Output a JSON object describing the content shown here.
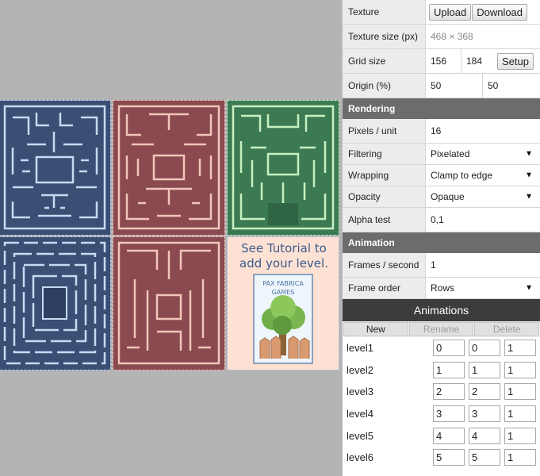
{
  "panel": {
    "texture": {
      "label": "Texture",
      "upload": "Upload",
      "download": "Download"
    },
    "texture_size": {
      "label": "Texture size (px)",
      "value": "468 × 368"
    },
    "grid_size": {
      "label": "Grid size",
      "w": "156",
      "h": "184",
      "setup": "Setup"
    },
    "origin": {
      "label": "Origin (%)",
      "x": "50",
      "y": "50"
    },
    "rendering": {
      "title": "Rendering",
      "pixels_label": "Pixels / unit",
      "pixels": "16",
      "filtering_label": "Filtering",
      "filtering": "Pixelated",
      "wrapping_label": "Wrapping",
      "wrapping": "Clamp to edge",
      "opacity_label": "Opacity",
      "opacity": "Opaque",
      "alpha_label": "Alpha test",
      "alpha": "0,1"
    },
    "animation": {
      "title": "Animation",
      "fps_label": "Frames / second",
      "fps": "1",
      "order_label": "Frame order",
      "order": "Rows"
    }
  },
  "animations": {
    "title": "Animations",
    "new": "New",
    "rename": "Rename",
    "delete": "Delete",
    "rows": [
      {
        "name": "level1",
        "start": "0",
        "end": "0",
        "count": "1"
      },
      {
        "name": "level2",
        "start": "1",
        "end": "1",
        "count": "1"
      },
      {
        "name": "level3",
        "start": "2",
        "end": "2",
        "count": "1"
      },
      {
        "name": "level4",
        "start": "3",
        "end": "3",
        "count": "1"
      },
      {
        "name": "level5",
        "start": "4",
        "end": "4",
        "count": "1"
      },
      {
        "name": "level6",
        "start": "5",
        "end": "5",
        "count": "1"
      }
    ]
  },
  "tutorial": {
    "line1": "See Tutorial to",
    "line2": "add your level.",
    "book_line1": "PAX FABRICA",
    "book_line2": "GAMES"
  },
  "colors": {
    "bg": "#b4b4b4",
    "blue_tile": "#3b4f75",
    "blue_line": "#c6daf2",
    "red_tile": "#8a4a4f",
    "red_line": "#f2c6b8",
    "green_tile": "#3c7a54",
    "green_line": "#c8f0c0",
    "tutorial_bg": "#fde2d4",
    "tutorial_text": "#3c5a8c"
  }
}
